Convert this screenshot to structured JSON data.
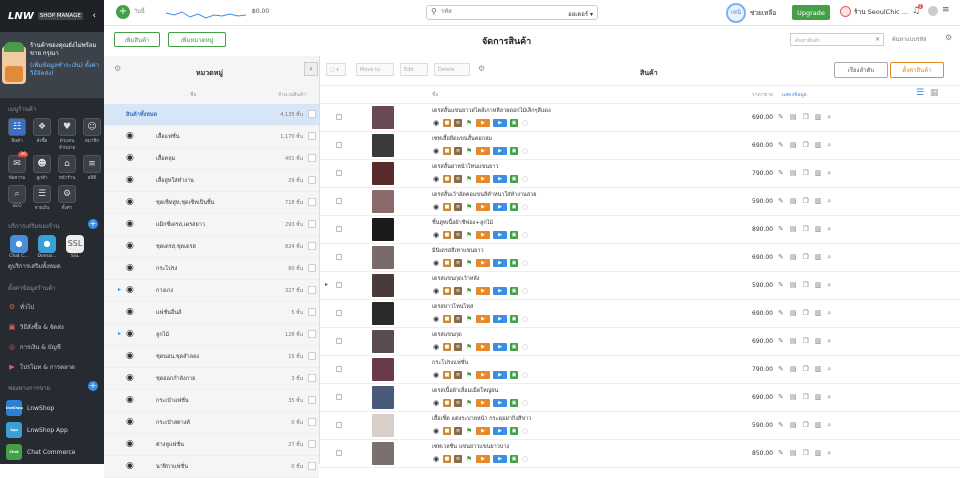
{
  "sidebar": {
    "logo": "LNW",
    "manage": "SHOP MANAGE",
    "shop_name": "ร้านค้าของคุณยังไม่พร้อมขาย กรุณา",
    "shop_links": "(เพิ่มข้อมูลชำระเงิน) ตั้งค่าวิธีจัดส่ง)",
    "section_manage": "เมนูร้านค้า",
    "tiles": [
      {
        "label": "สินค้า",
        "icon": "shirt-icon",
        "active": true
      },
      {
        "label": "สั่งซื้อ",
        "icon": "cart-icon"
      },
      {
        "label": "ตัวแทนจำหน่าย",
        "icon": "piggy-icon"
      },
      {
        "label": "สมาชิก",
        "icon": "members-icon"
      },
      {
        "label": "ข้อความ",
        "icon": "message-icon",
        "badge": "36"
      },
      {
        "label": "ลูกค้า",
        "icon": "customer-icon"
      },
      {
        "label": "หน้าร้าน",
        "icon": "store-icon"
      },
      {
        "label": "สถิติ",
        "icon": "chart-icon"
      },
      {
        "label": "SEO",
        "icon": "seo-icon"
      },
      {
        "label": "จ่ายเงิน",
        "icon": "wallet-icon"
      },
      {
        "label": "ตั้งค่า",
        "icon": "settings-icon"
      }
    ],
    "section_services": "บริการเสริมของร้าน",
    "apps": [
      {
        "label": "Chat C..."
      },
      {
        "label": "Domai..."
      },
      {
        "label": "SSL",
        "text": "SSL"
      }
    ],
    "services_link": "ดูบริการเสริมทั้งหมด",
    "section_settings": "ตั้งค่าข้อมูลร้านค้า",
    "menu": [
      {
        "label": "ทั่วไป",
        "icon": "settings-icon"
      },
      {
        "label": "วิธีสั่งซื้อ & จัดส่ง",
        "icon": "truck-icon"
      },
      {
        "label": "การเงิน & บัญชี",
        "icon": "money-icon"
      },
      {
        "label": "โปรโมท & การตลาด",
        "icon": "megaphone-icon"
      }
    ],
    "section_channels": "ช่องทางการขาย",
    "channels": [
      {
        "label": "LnwShop",
        "badge": "lnwShop"
      },
      {
        "label": "LnwShop App",
        "badge": "App"
      },
      {
        "label": "Chat Commerce",
        "badge": "Chat"
      }
    ]
  },
  "topbar": {
    "today": "วันนี้",
    "sales": "฿0.00",
    "search_placeholder": "รหัส",
    "search_type": "ออเดอร์",
    "ring": "เซนิ",
    "help": "ช่วยเหลือ",
    "upgrade": "Upgrade",
    "store": "ร้าน SeoulChic ...",
    "bell_badge": "4"
  },
  "actions": {
    "add_product": "เพิ่มสินค้า",
    "add_category": "เพิ่มหมวดหมู่",
    "page_title": "จัดการสินค้า",
    "filter_placeholder": "ค้นหาสินค้า",
    "code_label": "ค้นหาแบบรหัส"
  },
  "categories": {
    "title": "หมวดหมู่",
    "col_name": "ชื่อ",
    "col_count": "จำนวนสินค้า",
    "items": [
      {
        "name": "สินค้าทั้งหมด",
        "count": "4,135 ชิ้น",
        "selected": true
      },
      {
        "name": "เสื้อแฟชั่น",
        "count": "1,170 ชิ้น"
      },
      {
        "name": "เสื้อคลุม",
        "count": "401 ชิ้น"
      },
      {
        "name": "เสื้อสูทใส่ทำงาน",
        "count": "29 ชิ้น"
      },
      {
        "name": "ชุดเซ็ทสูท,ชุดเซ็ทเป็นชิ้น",
        "count": "718 ชิ้น"
      },
      {
        "name": "แม็กซี่เดรส,เดรสยาว",
        "count": "293 ชิ้น"
      },
      {
        "name": "ชุดเดรส,ชุดเดรส",
        "count": "824 ชิ้น"
      },
      {
        "name": "กระโปรง",
        "count": "80 ชิ้น"
      },
      {
        "name": "กางเกง",
        "count": "327 ชิ้น",
        "arrow": true
      },
      {
        "name": "แฟชั่นอื่นส์",
        "count": "5 ชิ้น"
      },
      {
        "name": "ลูกไม้",
        "count": "128 ชิ้น",
        "arrow": true
      },
      {
        "name": "ชุดนอน,ชุดสำลอง",
        "count": "15 ชิ้น"
      },
      {
        "name": "ชุดออกกำลังกาย",
        "count": "3 ชิ้น"
      },
      {
        "name": "กระเป๋าแฟชั่น",
        "count": "35 ชิ้น"
      },
      {
        "name": "กระเป๋าสตางค์",
        "count": "0 ชิ้น"
      },
      {
        "name": "ต่างหูแฟชั่น",
        "count": "27 ชิ้น"
      },
      {
        "name": "นาฬิกาแฟชั่น",
        "count": "0 ชิ้น"
      }
    ]
  },
  "toolbar": {
    "move": "Move to",
    "edit": "Edit",
    "delete": "Delete"
  },
  "products": {
    "title": "สินค้า",
    "sort": "เรียงลำดับ",
    "add": "ตั้งค่าสินค้า",
    "col_name": "ชื่อ",
    "col_price": "ราคาขาย",
    "show_info": "แสดงข้อมูล",
    "items": [
      {
        "name": "เดรสสั้นแขนยาวสไตล์เกาหลีลายดอกไม้เล็กๆสีแดง",
        "price": "690.00",
        "color": "#6a4a52"
      },
      {
        "name": "เซทเสื้อยืดแขนสั้นคอกลม",
        "price": "690.00",
        "color": "#3a3a3a"
      },
      {
        "name": "เดรสสั้นผ่าหน้าโทนแขนยาว",
        "price": "790.00",
        "color": "#5a2a2a"
      },
      {
        "name": "เดรสสั้นเว้าอัดคอแขนลีคำหนาใส่ทำงานสวย",
        "price": "590.00",
        "color": "#8a6a6a"
      },
      {
        "name": "ชิ้นสูทเนื้อผ้าชีฟอง+ลูกไม้",
        "price": "890.00",
        "color": "#1a1a1a"
      },
      {
        "name": "มินิเดรสสีเทาแขนยาว",
        "price": "690.00",
        "color": "#7a6a6a"
      },
      {
        "name": "เดรสแขนกุดเว้าหลัง",
        "price": "590.00",
        "color": "#4a3a3a",
        "expand": true
      },
      {
        "name": "เดรสยาวโทนไหล่",
        "price": "690.00",
        "color": "#2a2a2a"
      },
      {
        "name": "เดรสแขนกุด",
        "price": "690.00",
        "color": "#5a4a52"
      },
      {
        "name": "กระโปรงแฟชั่น",
        "price": "790.00",
        "color": "#6a3a4a"
      },
      {
        "name": "เดรสเนื้อผ้าเลื่อมเม็ดใหญ่ฝน",
        "price": "690.00",
        "color": "#4a5a7a"
      },
      {
        "name": "เสื้อเชิ้ต แต่งระบายหน้า กระดุมผ่ากิ่งสีขาว",
        "price": "590.00",
        "color": "#d8d0c8"
      },
      {
        "name": "เซทเวลชีน แขนยาวแขนยาวบาง",
        "price": "850.00",
        "color": "#7a7070"
      }
    ]
  },
  "colors": {
    "green": "#43a047",
    "blue": "#3a8ee6",
    "orange": "#e58a2a"
  }
}
